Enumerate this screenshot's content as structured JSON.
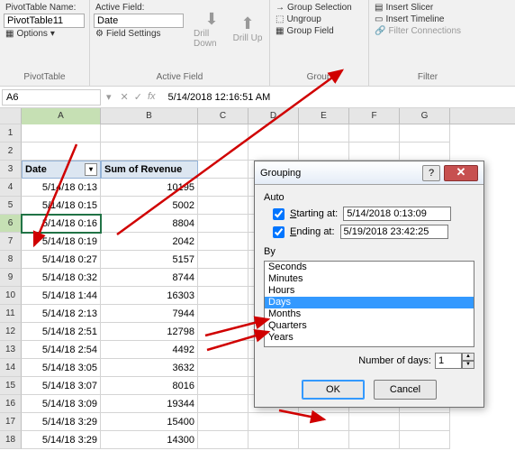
{
  "ribbon": {
    "pivottable": {
      "name_label": "PivotTable Name:",
      "name_value": "PivotTable11",
      "options_label": "Options",
      "group_title": "PivotTable"
    },
    "activefield": {
      "label": "Active Field:",
      "value": "Date",
      "field_settings": "Field Settings",
      "drill_down": "Drill Down",
      "drill_up": "Drill Up",
      "group_title": "Active Field"
    },
    "group": {
      "selection": "Group Selection",
      "ungroup": "Ungroup",
      "field": "Group Field",
      "group_title": "Group"
    },
    "filter": {
      "slicer": "Insert Slicer",
      "timeline": "Insert Timeline",
      "connections": "Filter Connections",
      "group_title": "Filter"
    }
  },
  "formula_bar": {
    "name_box": "A6",
    "fx": "fx",
    "value": "5/14/2018 12:16:51 AM"
  },
  "columns": [
    "A",
    "B",
    "C",
    "D",
    "E",
    "F",
    "G"
  ],
  "pivot_headers": {
    "date": "Date",
    "revenue": "Sum of Revenue"
  },
  "rows": [
    {
      "n": "1",
      "a": "",
      "b": ""
    },
    {
      "n": "2",
      "a": "",
      "b": ""
    },
    {
      "n": "3",
      "header": true
    },
    {
      "n": "4",
      "a": "5/14/18 0:13",
      "b": "10195"
    },
    {
      "n": "5",
      "a": "5/14/18 0:15",
      "b": "5002"
    },
    {
      "n": "6",
      "a": "5/14/18 0:16",
      "b": "8804",
      "selected": true
    },
    {
      "n": "7",
      "a": "5/14/18 0:19",
      "b": "2042"
    },
    {
      "n": "8",
      "a": "5/14/18 0:27",
      "b": "5157"
    },
    {
      "n": "9",
      "a": "5/14/18 0:32",
      "b": "8744"
    },
    {
      "n": "10",
      "a": "5/14/18 1:44",
      "b": "16303"
    },
    {
      "n": "11",
      "a": "5/14/18 2:13",
      "b": "7944"
    },
    {
      "n": "12",
      "a": "5/14/18 2:51",
      "b": "12798"
    },
    {
      "n": "13",
      "a": "5/14/18 2:54",
      "b": "4492"
    },
    {
      "n": "14",
      "a": "5/14/18 3:05",
      "b": "3632"
    },
    {
      "n": "15",
      "a": "5/14/18 3:07",
      "b": "8016"
    },
    {
      "n": "16",
      "a": "5/14/18 3:09",
      "b": "19344"
    },
    {
      "n": "17",
      "a": "5/14/18 3:29",
      "b": "15400"
    },
    {
      "n": "18",
      "a": "5/14/18 3:29",
      "b": "14300"
    }
  ],
  "dialog": {
    "title": "Grouping",
    "auto": "Auto",
    "starting_label": "Starting at:",
    "starting_value": "5/14/2018 0:13:09",
    "ending_label": "Ending at:",
    "ending_value": "5/19/2018 23:42:25",
    "by": "By",
    "options": [
      "Seconds",
      "Minutes",
      "Hours",
      "Days",
      "Months",
      "Quarters",
      "Years"
    ],
    "selected_option": "Days",
    "numdays_label": "Number of days:",
    "numdays_value": "1",
    "ok": "OK",
    "cancel": "Cancel"
  }
}
